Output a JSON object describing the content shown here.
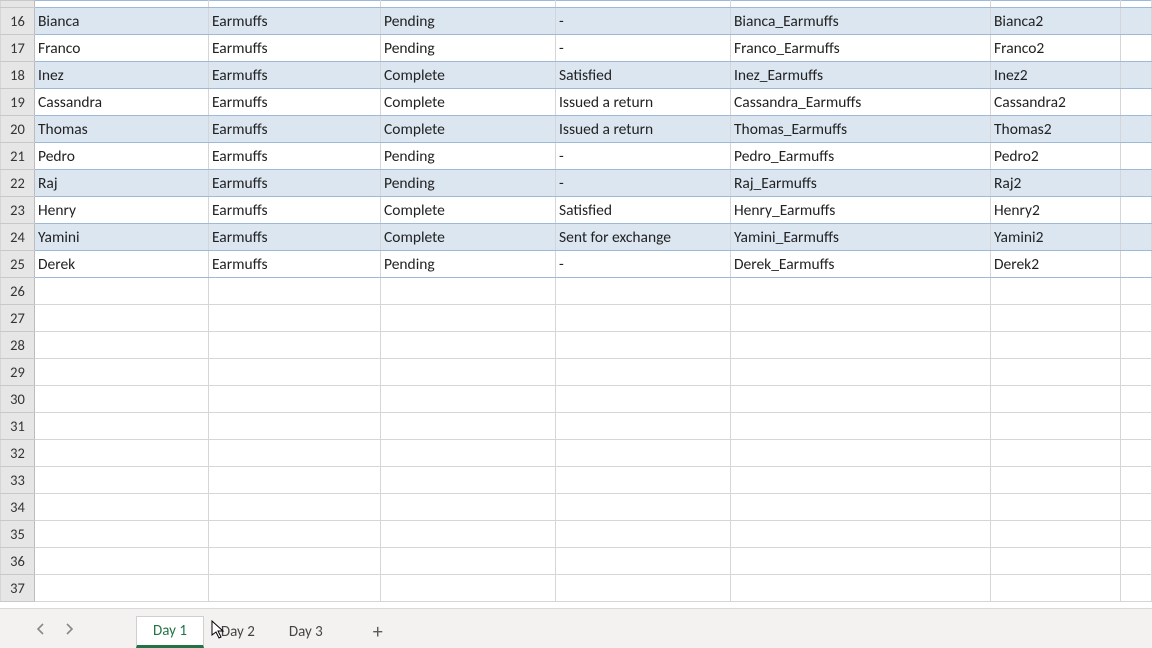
{
  "rows": [
    {
      "num": 16,
      "banded": true,
      "name": "Bianca",
      "product": "Earmuffs",
      "status": "Pending",
      "disposition": "-",
      "key": "Bianca_Earmuffs",
      "short": "Bianca2"
    },
    {
      "num": 17,
      "banded": false,
      "name": "Franco",
      "product": "Earmuffs",
      "status": "Pending",
      "disposition": "-",
      "key": "Franco_Earmuffs",
      "short": "Franco2"
    },
    {
      "num": 18,
      "banded": true,
      "name": "Inez",
      "product": "Earmuffs",
      "status": "Complete",
      "disposition": "Satisfied",
      "key": "Inez_Earmuffs",
      "short": "Inez2"
    },
    {
      "num": 19,
      "banded": false,
      "name": "Cassandra",
      "product": "Earmuffs",
      "status": "Complete",
      "disposition": "Issued a return",
      "key": "Cassandra_Earmuffs",
      "short": "Cassandra2"
    },
    {
      "num": 20,
      "banded": true,
      "name": "Thomas",
      "product": "Earmuffs",
      "status": "Complete",
      "disposition": "Issued a return",
      "key": "Thomas_Earmuffs",
      "short": "Thomas2"
    },
    {
      "num": 21,
      "banded": false,
      "name": "Pedro",
      "product": "Earmuffs",
      "status": "Pending",
      "disposition": "-",
      "key": "Pedro_Earmuffs",
      "short": "Pedro2"
    },
    {
      "num": 22,
      "banded": true,
      "name": "Raj",
      "product": "Earmuffs",
      "status": "Pending",
      "disposition": "-",
      "key": "Raj_Earmuffs",
      "short": "Raj2"
    },
    {
      "num": 23,
      "banded": false,
      "name": "Henry",
      "product": "Earmuffs",
      "status": "Complete",
      "disposition": "Satisfied",
      "key": "Henry_Earmuffs",
      "short": "Henry2"
    },
    {
      "num": 24,
      "banded": true,
      "name": "Yamini",
      "product": "Earmuffs",
      "status": "Complete",
      "disposition": "Sent for exchange",
      "key": "Yamini_Earmuffs",
      "short": "Yamini2"
    },
    {
      "num": 25,
      "banded": false,
      "name": "Derek",
      "product": "Earmuffs",
      "status": "Pending",
      "disposition": "-",
      "key": "Derek_Earmuffs",
      "short": "Derek2"
    }
  ],
  "empty_row_start": 26,
  "empty_row_end": 37,
  "tabs": {
    "active_index": 0,
    "items": [
      {
        "label": "Day 1"
      },
      {
        "label": "Day 2"
      },
      {
        "label": "Day 3"
      }
    ],
    "add_label": "+"
  }
}
